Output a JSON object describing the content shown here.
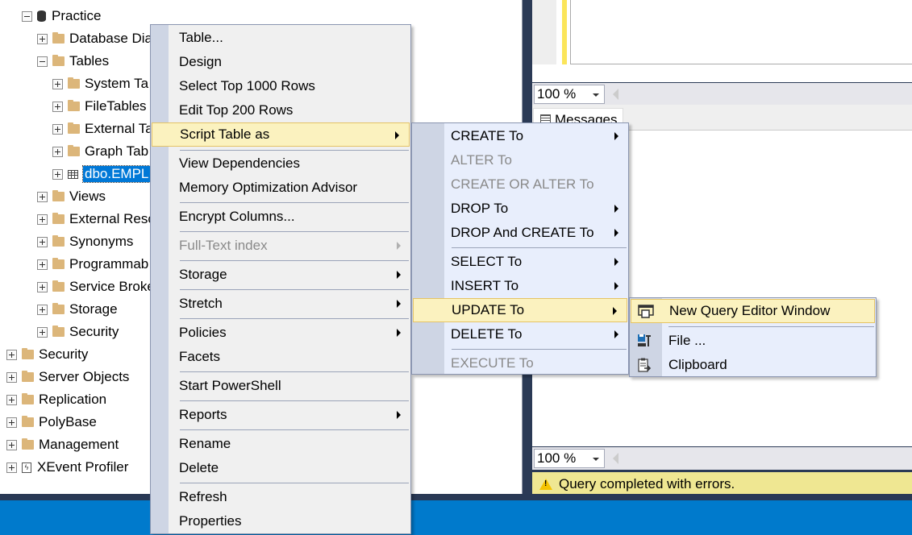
{
  "object_explorer": {
    "items": [
      {
        "label": "Practice",
        "expander": "minus",
        "icon": "database-icon"
      },
      {
        "label": "Database Dia",
        "expander": "plus",
        "icon": "folder-icon"
      },
      {
        "label": "Tables",
        "expander": "minus",
        "icon": "folder-icon"
      },
      {
        "label": "System Ta",
        "expander": "plus",
        "icon": "folder-icon"
      },
      {
        "label": "FileTables",
        "expander": "plus",
        "icon": "folder-icon"
      },
      {
        "label": "External Ta",
        "expander": "plus",
        "icon": "folder-icon"
      },
      {
        "label": "Graph Tab",
        "expander": "plus",
        "icon": "folder-icon"
      },
      {
        "label": "dbo.EMPL",
        "expander": "plus",
        "icon": "table-icon",
        "selected": true
      },
      {
        "label": "Views",
        "expander": "plus",
        "icon": "folder-icon"
      },
      {
        "label": "External Reso",
        "expander": "plus",
        "icon": "folder-icon"
      },
      {
        "label": "Synonyms",
        "expander": "plus",
        "icon": "folder-icon"
      },
      {
        "label": "Programmab",
        "expander": "plus",
        "icon": "folder-icon"
      },
      {
        "label": "Service Broke",
        "expander": "plus",
        "icon": "folder-icon"
      },
      {
        "label": "Storage",
        "expander": "plus",
        "icon": "folder-icon"
      },
      {
        "label": "Security",
        "expander": "plus",
        "icon": "folder-icon"
      },
      {
        "label": "Security",
        "expander": "plus",
        "icon": "folder-icon"
      },
      {
        "label": "Server Objects",
        "expander": "plus",
        "icon": "folder-icon"
      },
      {
        "label": "Replication",
        "expander": "plus",
        "icon": "folder-icon"
      },
      {
        "label": "PolyBase",
        "expander": "plus",
        "icon": "folder-icon"
      },
      {
        "label": "Management",
        "expander": "plus",
        "icon": "folder-icon"
      },
      {
        "label": "XEvent Profiler",
        "expander": "plus",
        "icon": "xevent-icon"
      }
    ]
  },
  "query_pane": {
    "top_zoom": "100 %",
    "messages_tab": "Messages",
    "bottom_zoom": "100 %",
    "status": "Query completed with errors."
  },
  "context_menu": {
    "items": [
      {
        "label": "Table...",
        "submenu": false,
        "disabled": false
      },
      {
        "label": "Design",
        "submenu": false,
        "disabled": false
      },
      {
        "label": "Select Top 1000 Rows",
        "submenu": false,
        "disabled": false
      },
      {
        "label": "Edit Top 200 Rows",
        "submenu": false,
        "disabled": false
      },
      {
        "label": "Script Table as",
        "submenu": true,
        "disabled": false,
        "highlighted": true
      },
      {
        "label": "View Dependencies",
        "submenu": false,
        "disabled": false
      },
      {
        "label": "Memory Optimization Advisor",
        "submenu": false,
        "disabled": false
      },
      {
        "label": "Encrypt Columns...",
        "submenu": false,
        "disabled": false
      },
      {
        "label": "Full-Text index",
        "submenu": true,
        "disabled": true
      },
      {
        "label": "Storage",
        "submenu": true,
        "disabled": false
      },
      {
        "label": "Stretch",
        "submenu": true,
        "disabled": false
      },
      {
        "label": "Policies",
        "submenu": true,
        "disabled": false
      },
      {
        "label": "Facets",
        "submenu": false,
        "disabled": false
      },
      {
        "label": "Start PowerShell",
        "submenu": false,
        "disabled": false
      },
      {
        "label": "Reports",
        "submenu": true,
        "disabled": false
      },
      {
        "label": "Rename",
        "submenu": false,
        "disabled": false
      },
      {
        "label": "Delete",
        "submenu": false,
        "disabled": false
      },
      {
        "label": "Refresh",
        "submenu": false,
        "disabled": false
      },
      {
        "label": "Properties",
        "submenu": false,
        "disabled": false
      }
    ]
  },
  "script_submenu": {
    "items": [
      {
        "label": "CREATE To",
        "submenu": true,
        "disabled": false
      },
      {
        "label": "ALTER To",
        "submenu": false,
        "disabled": true
      },
      {
        "label": "CREATE OR ALTER To",
        "submenu": false,
        "disabled": true
      },
      {
        "label": "DROP To",
        "submenu": true,
        "disabled": false
      },
      {
        "label": "DROP And CREATE To",
        "submenu": true,
        "disabled": false
      },
      {
        "label": "SELECT To",
        "submenu": true,
        "disabled": false
      },
      {
        "label": "INSERT To",
        "submenu": true,
        "disabled": false
      },
      {
        "label": "UPDATE To",
        "submenu": true,
        "disabled": false,
        "highlighted": true
      },
      {
        "label": "DELETE To",
        "submenu": true,
        "disabled": false
      },
      {
        "label": "EXECUTE To",
        "submenu": false,
        "disabled": true
      }
    ]
  },
  "target_submenu": {
    "items": [
      {
        "label": "New Query Editor Window",
        "icon": "new-query-window-icon",
        "highlighted": true
      },
      {
        "label": "File ...",
        "icon": "save-file-icon"
      },
      {
        "label": "Clipboard",
        "icon": "clipboard-icon"
      }
    ]
  },
  "colors": {
    "selection": "#0078d7",
    "menu_highlight": "#fbf2bf",
    "status_warning": "#efe792",
    "taskbar": "#007acc"
  }
}
